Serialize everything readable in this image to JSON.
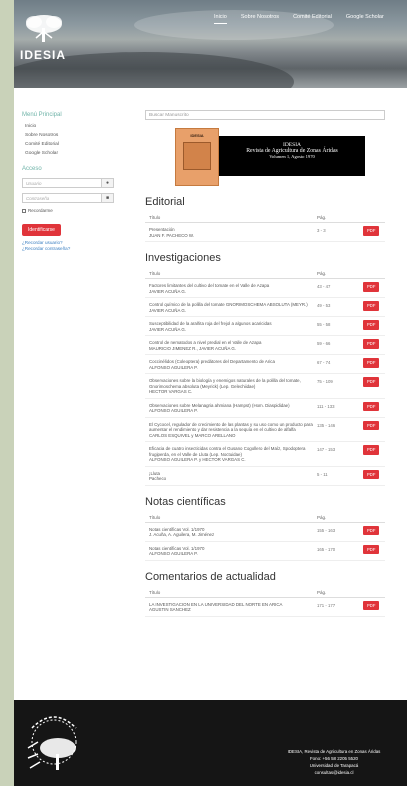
{
  "header": {
    "logo_text": "IDESIA",
    "nav": [
      "Inicio",
      "Sobre Nosotros",
      "Comité Editorial",
      "Google Scholar"
    ]
  },
  "sidebar": {
    "menu_title": "Menú Principal",
    "menu_items": [
      "Inicio",
      "Sobre Nosotros",
      "Comité Editorial",
      "Google Scholar"
    ],
    "access_title": "Acceso",
    "user_placeholder": "Usuario",
    "password_placeholder": "Contraseña",
    "remember_label": "Recordarme",
    "login_label": "Identificarse",
    "forgot_user": "¿Recordar usuario?",
    "forgot_password": "¿Recordar contraseña?"
  },
  "main": {
    "search_placeholder": "Buscar Manuscrito",
    "banner": {
      "cover_title": "IDESIA",
      "line1": "IDESIA",
      "line2": "Revista de Agricultura de Zonas Áridas",
      "line3": "Volumen 1, Agosto 1970"
    },
    "col_title": "Título",
    "col_pag": "Pág.",
    "pdf_label": "PDF",
    "sections": [
      {
        "title": "Editorial",
        "rows": [
          {
            "title": "Presentación",
            "authors": "JUAN F. PACHECO W.",
            "pag": "3 - 3"
          }
        ]
      },
      {
        "title": "Investigaciones",
        "rows": [
          {
            "title": "Factores limitantes del cultivo del tomate en el Valle de Azapa",
            "authors": "JAVIER ACUÑA G.",
            "pag": "43 - 47"
          },
          {
            "title": "Control químico de la polilla del tomate GNORIMOSCHEMA ABSOLUTA (MEYR.)",
            "authors": "JAVIER ACUÑA G.",
            "pag": "49 - 53"
          },
          {
            "title": "Susceptibilidad de la arañita roja del frejol a algunos acaricidas",
            "authors": "JAVIER ACUÑA G.",
            "pag": "55 - 58"
          },
          {
            "title": "Control de nematodos a nivel predial en el Valle de Azapa",
            "authors": "MAURICIO JIMENEZ R., JAVIER ACUÑA G.",
            "pag": "59 - 66"
          },
          {
            "title": "Coccinélidos (Coleoptera) predátores del Departamento de Arica",
            "authors": "ALFONSO AGUILERA P.",
            "pag": "67 - 74"
          },
          {
            "title": "Observaciones sobre la biología y enemigos naturales de la polilla del tomate, Gnorimoschema absoluta (Meyrick) (Lep. Gelechiidae)",
            "authors": "HECTOR VARGAS C.",
            "pag": "75 - 109"
          },
          {
            "title": "Observaciones sobre Melanagria ahmiana (Hampst) (Hom. Diaspididae)",
            "authors": "ALFONSO AGUILERA P.",
            "pag": "111 - 133"
          },
          {
            "title": "El Cycocel, regulador de crecimiento de las plantas y su uso como un producto para aumentar el rendimiento y dar resistencia a la sequía en el cultivo de alfalfa",
            "authors": "CARLOS ESQUIVEL y MARCO ARELLANO",
            "pag": "135 - 146"
          },
          {
            "title": "Eficacia de cuatro insecticidas contra el Gusano Cogollero del Maíz, Spodoptera frugiperda, en el Valle de Lluta (Lep. Noctuidae)",
            "authors": "ALFONSO AGUILERA P. y HECTOR VARGAS C.",
            "pag": "147 - 153"
          },
          {
            "title": "¡Lluta",
            "authors": "Pacheco",
            "pag": "5 - 11"
          }
        ]
      },
      {
        "title": "Notas científicas",
        "rows": [
          {
            "title": "Notas científicas Vol. 1/1970",
            "authors": "J. Acuña, A. Aguilera, M. Jiménez",
            "pag": "155 - 163"
          },
          {
            "title": "Notas científicas Vol. 1/1970",
            "authors": "ALFONSO AGUILERA P.",
            "pag": "165 - 170"
          }
        ]
      },
      {
        "title": "Comentarios de actualidad",
        "rows": [
          {
            "title": "LA INVESTIGACION EN LA UNIVERSIDAD DEL NORTE EN ARICA",
            "authors": "AGUSTIN SANCHEZ",
            "pag": "171 - 177"
          }
        ]
      }
    ]
  },
  "footer": {
    "lines": [
      "IDESIA, Revista de Agricultura en Zonas Áridas",
      "Fono: +56 58 2205 5520",
      "Universidad de Tarapacá",
      "consultas@idesia.cl"
    ]
  },
  "colors": {
    "accent": "#e0343a",
    "teal": "#6fb3a8",
    "strip": "#c9d2b9",
    "footer": "#151515"
  }
}
